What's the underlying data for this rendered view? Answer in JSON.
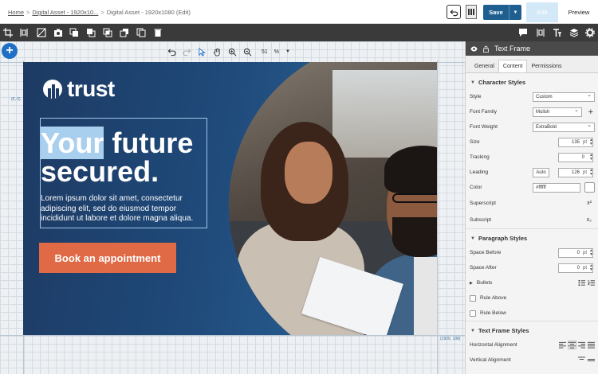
{
  "header": {
    "breadcrumb": [
      "Home",
      "Digital Asset - 1920x10...",
      "Digital Asset - 1920x1080 (Edit)"
    ],
    "save_label": "Save",
    "edit_label": "Edit",
    "preview_label": "Preview"
  },
  "canvas": {
    "zoom_value": "51",
    "zoom_unit": "%",
    "coord_origin": "(0, 0)",
    "coord_end": "(1920, 108("
  },
  "banner": {
    "logo_text": "trust",
    "headline_highlight": "Your",
    "headline_rest": " future",
    "headline_line2": "secured.",
    "body": "Lorem ipsum dolor sit amet, consectetur adipiscing elit, sed do eiusmod tempor incididunt ut labore et dolore magna aliqua.",
    "cta": "Book an appointment",
    "colors": {
      "background": "#1e3d66",
      "cta": "#e06a46",
      "highlight": "#a9cfee"
    }
  },
  "panel": {
    "title": "Text Frame",
    "tabs": [
      "General",
      "Content",
      "Permissions"
    ],
    "active_tab": "Content",
    "character_styles": {
      "title": "Character Styles",
      "style_label": "Style",
      "style_value": "Custom",
      "font_family_label": "Font Family",
      "font_family_value": "Mulish",
      "font_weight_label": "Font Weight",
      "font_weight_value": "ExtraBold",
      "size_label": "Size",
      "size_value": "135",
      "size_unit": "pt",
      "tracking_label": "Tracking",
      "tracking_value": "0",
      "leading_label": "Leading",
      "leading_auto": "Auto",
      "leading_value": "126",
      "leading_unit": "pt",
      "color_label": "Color",
      "color_value": "#ffffff",
      "superscript_label": "Superscript",
      "subscript_label": "Subscript",
      "superscript_glyph": "x²",
      "subscript_glyph": "x₂"
    },
    "paragraph_styles": {
      "title": "Paragraph Styles",
      "space_before_label": "Space Before",
      "space_before_value": "0",
      "space_before_unit": "pt",
      "space_after_label": "Space After",
      "space_after_value": "0",
      "space_after_unit": "pt",
      "bullets_label": "Bullets",
      "rule_above_label": "Rule Above",
      "rule_below_label": "Rule Below"
    },
    "text_frame_styles": {
      "title": "Text Frame Styles",
      "horizontal_alignment_label": "Horizontal Alignment",
      "vertical_alignment_label": "Vertical Alignment"
    }
  }
}
